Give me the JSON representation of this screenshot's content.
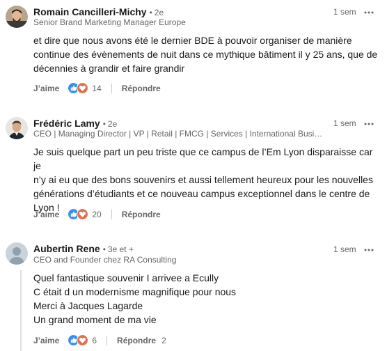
{
  "comments": [
    {
      "author": "Romain Cancilleri-Michy",
      "degree": "2e",
      "headline": "Senior Brand Marketing Manager Europe",
      "time": "1 sem",
      "text": [
        "et dire que nous avons été le dernier BDE à pouvoir organiser de manière",
        "continue des évènements de nuit dans ce mythique bâtiment il y 25 ans, que de",
        "décennies à grandir et faire grandir"
      ],
      "like_label": "J’aime",
      "reaction_count": "14",
      "reply_label": "Répondre"
    },
    {
      "author": "Frédéric Lamy",
      "degree": "2e",
      "headline": "CEO | Managing Director | VP | Retail | FMCG | Services | International Busine...",
      "time": "1 sem",
      "text": [
        "Je suis quelque part un peu triste que ce campus de l’Em Lyon disparaisse car je",
        "n’y ai eu que des bons souvenirs et aussi tellement heureux pour les nouvelles",
        "générations d’étudiants et ce nouveau campus exceptionnel dans le centre de",
        "Lyon !"
      ],
      "like_label": "J’aime",
      "reaction_count": "20",
      "reply_label": "Répondre"
    },
    {
      "author": "Aubertin Rene",
      "degree": "3e et +",
      "headline": "CEO and Founder chez RA Consulting",
      "time": "1 sem",
      "text": [
        "Quel fantastique souvenir I arrivee a Ecully",
        "C était d un modernisme magnifique pour nous",
        "Merci à Jacques Lagarde",
        "Un grand moment de ma vie"
      ],
      "like_label": "J’aime",
      "reaction_count": "6",
      "reply_label": "Répondre",
      "reply_count": "2"
    }
  ],
  "colors": {
    "like_blue": "#378fe9",
    "love_red": "#df704d",
    "text_primary": "#191919",
    "text_secondary": "#666666"
  },
  "icons": {
    "like": "thumbs-up-icon",
    "love": "heart-icon",
    "more": "ellipsis-icon"
  }
}
